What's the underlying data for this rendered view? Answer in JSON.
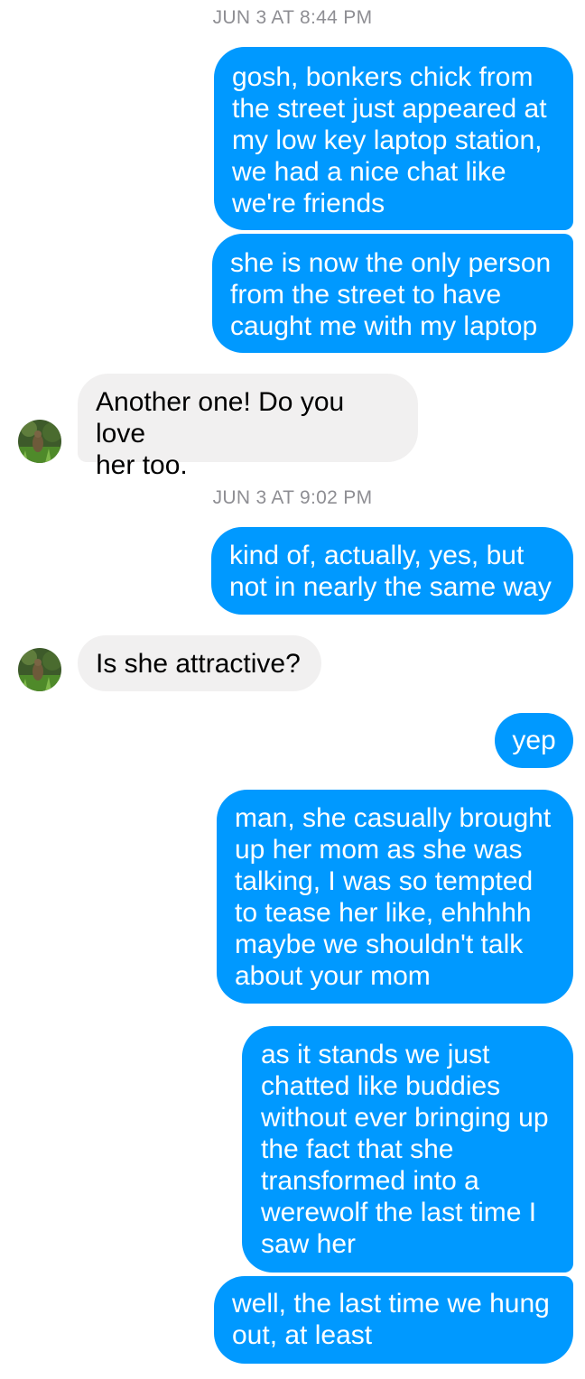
{
  "conversation": {
    "timestamps": [
      "JUN 3 AT 8:44 PM",
      "JUN 3 AT 9:02 PM"
    ],
    "messages": [
      {
        "direction": "outgoing",
        "text": "gosh, bonkers chick from\nthe street just appeared at\nmy low key laptop station,\nwe had a nice chat like\nwe're friends"
      },
      {
        "direction": "outgoing",
        "text": "she is now the only person\nfrom the street to have\ncaught me with my laptop"
      },
      {
        "direction": "incoming",
        "text": "Another one! Do you love\nher too."
      },
      {
        "direction": "outgoing",
        "text": "kind of, actually, yes, but\nnot in nearly the same way"
      },
      {
        "direction": "incoming",
        "text": "Is she attractive?"
      },
      {
        "direction": "outgoing",
        "text": "yep"
      },
      {
        "direction": "outgoing",
        "text": "man, she casually brought\nup her mom as she was\ntalking, I was so tempted\nto tease her like, ehhhhh\nmaybe we shouldn't talk\nabout your mom"
      },
      {
        "direction": "outgoing",
        "text": "as it stands we just\nchatted like buddies\nwithout ever bringing up\nthe fact that she\ntransformed into a\nwerewolf the last time I\nsaw her"
      },
      {
        "direction": "outgoing",
        "text": "well, the last time we hung\nout, at least"
      }
    ]
  },
  "colors": {
    "outgoing_bubble": "#0099ff",
    "incoming_bubble": "#f1f0f0",
    "timestamp_text": "#8e8e93"
  },
  "icons": {
    "contact_avatar": "contact-avatar-icon"
  }
}
